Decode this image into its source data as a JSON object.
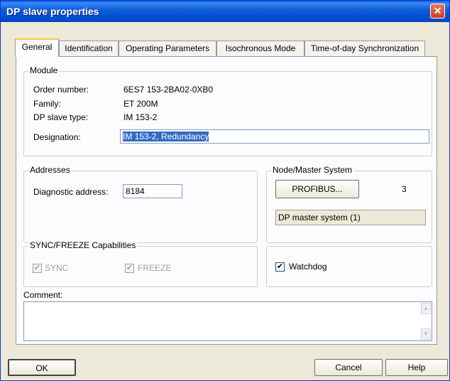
{
  "window": {
    "title": "DP slave properties",
    "close_glyph": "✕"
  },
  "tabs": [
    {
      "label": "General"
    },
    {
      "label": "Identification"
    },
    {
      "label": "Operating Parameters"
    },
    {
      "label": "Isochronous Mode"
    },
    {
      "label": "Time-of-day Synchronization"
    }
  ],
  "module": {
    "legend": "Module",
    "order_number_label": "Order number:",
    "order_number_value": "6ES7 153-2BA02-0XB0",
    "family_label": "Family:",
    "family_value": "ET 200M",
    "slave_type_label": "DP slave type:",
    "slave_type_value": "IM 153-2",
    "designation_label": "Designation:",
    "designation_value": "IM 153-2, Redundancy"
  },
  "addresses": {
    "legend": "Addresses",
    "diag_label": "Diagnostic address:",
    "diag_value": "8184"
  },
  "node": {
    "legend": "Node/Master System",
    "profibus_button": "PROFIBUS...",
    "node_number": "3",
    "master_system": "DP master system (1)"
  },
  "sync": {
    "legend": "SYNC/FREEZE Capabilities",
    "sync_label": "SYNC",
    "freeze_label": "FREEZE",
    "sync_checked": true,
    "freeze_checked": true,
    "check_glyph": "✔"
  },
  "watchdog": {
    "label": "Watchdog",
    "checked": true
  },
  "comment": {
    "label": "Comment:",
    "value": ""
  },
  "buttons": {
    "ok": "OK",
    "cancel": "Cancel",
    "help": "Help"
  }
}
